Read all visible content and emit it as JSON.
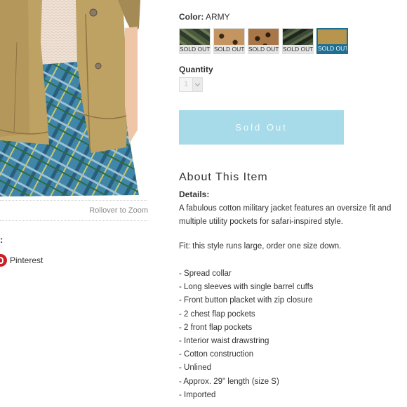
{
  "image": {
    "zoom_hint": "Rollover to Zoom"
  },
  "share": {
    "colon": ":",
    "pinterest_label": "Pinterest"
  },
  "product": {
    "color_label": "Color",
    "color_sep": ":",
    "color_value": "ARMY",
    "swatches": [
      {
        "name": "army-camo",
        "status": "SOLD OUT",
        "selected": false
      },
      {
        "name": "leopard-light",
        "status": "SOLD OUT",
        "selected": false
      },
      {
        "name": "leopard-dark",
        "status": "SOLD OUT",
        "selected": false
      },
      {
        "name": "army-camo-dark",
        "status": "SOLD OUT",
        "selected": false
      },
      {
        "name": "army-tan",
        "status": "SOLD OUT",
        "selected": true
      }
    ],
    "quantity_label": "Quantity",
    "quantity_value": "1",
    "sold_out_button": "Sold Out"
  },
  "about": {
    "heading": "About This Item",
    "details_label": "Details",
    "details_colon": ":",
    "description": "A fabulous cotton military jacket features an oversize fit and multiple utility pockets for safari-inspired style.",
    "fit": "Fit: this style runs large, order one size down.",
    "bullets": [
      "- Spread collar",
      "- Long sleeves with single barrel cuffs",
      "- Front button placket with zip closure",
      "- 2 chest flap pockets",
      "- 2 front flap pockets",
      "- Interior waist drawstring",
      "- Cotton construction",
      "- Unlined",
      "- Approx. 29\" length (size S)",
      "- Imported"
    ]
  },
  "colors": {
    "accent": "#1d6f93",
    "button": "#a8dbe9",
    "pinterest": "#cb2027"
  }
}
